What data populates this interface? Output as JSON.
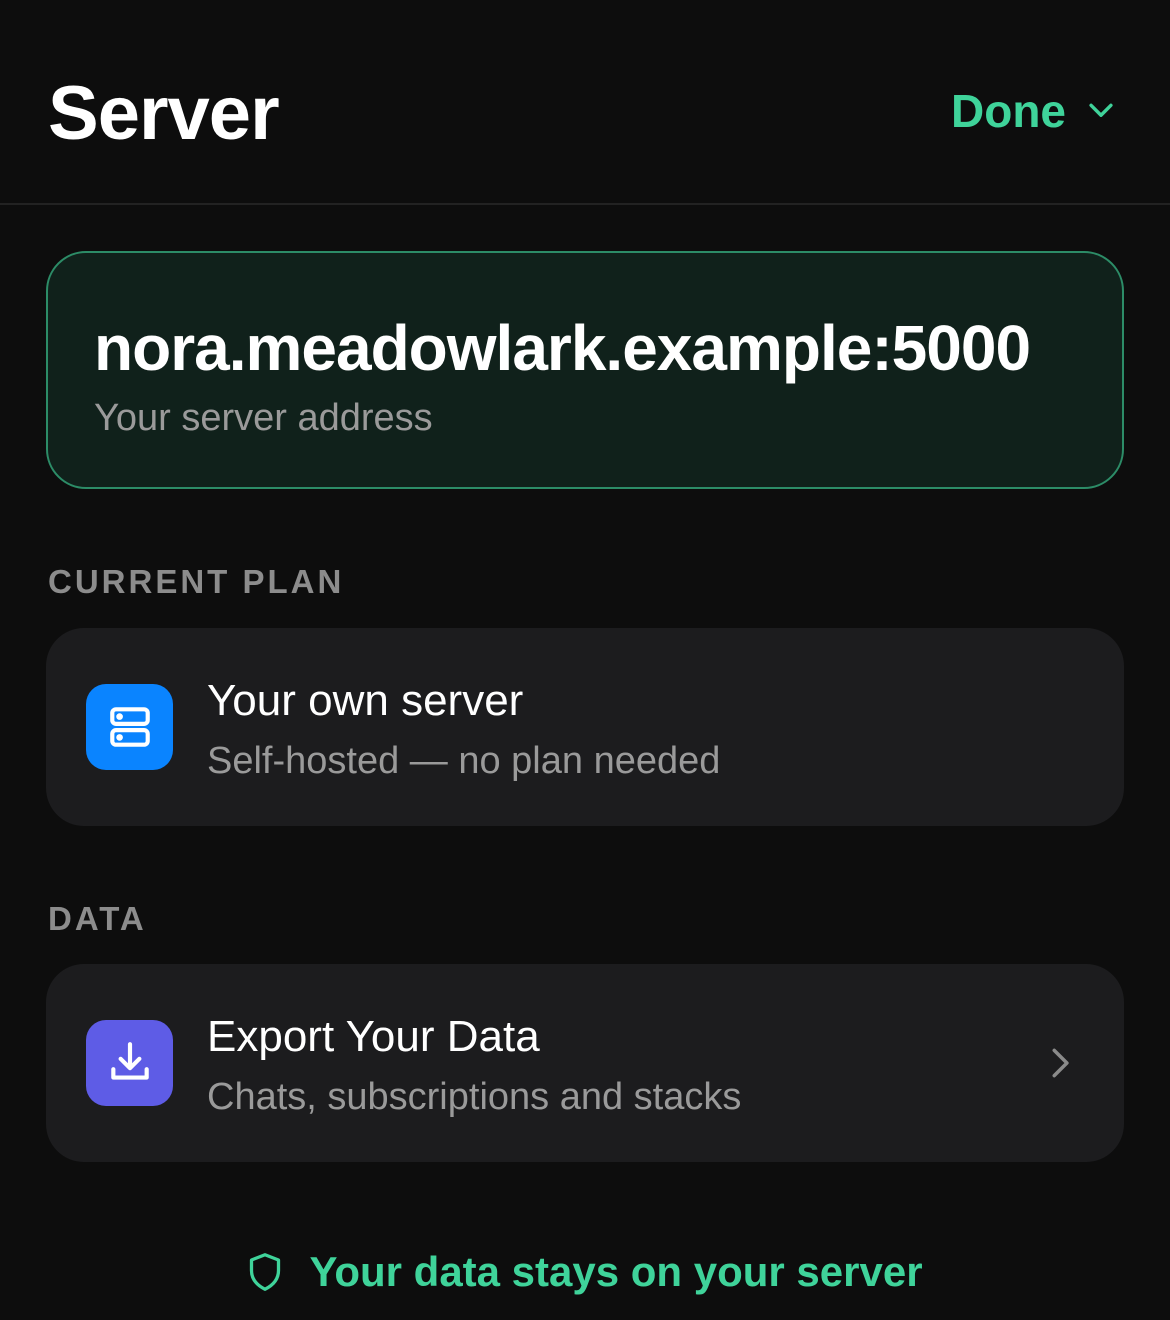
{
  "header": {
    "title": "Server",
    "done_label": "Done"
  },
  "server": {
    "address": "nora.meadowlark.example:5000",
    "caption": "Your server address"
  },
  "sections": {
    "plan_label": "CURRENT PLAN",
    "data_label": "DATA"
  },
  "plan_row": {
    "title": "Your own server",
    "subtitle": "Self-hosted — no plan needed",
    "icon": "server-icon",
    "icon_color": "#0a84ff"
  },
  "export_row": {
    "title": "Export Your Data",
    "subtitle": "Chats, subscriptions and stacks",
    "icon": "download-icon",
    "icon_color": "#5e5ce6"
  },
  "footer": {
    "note": "Your data stays on your server",
    "icon": "shield-icon"
  },
  "colors": {
    "accent": "#3fd39a",
    "background": "#0d0d0d",
    "card": "#1c1c1e"
  }
}
